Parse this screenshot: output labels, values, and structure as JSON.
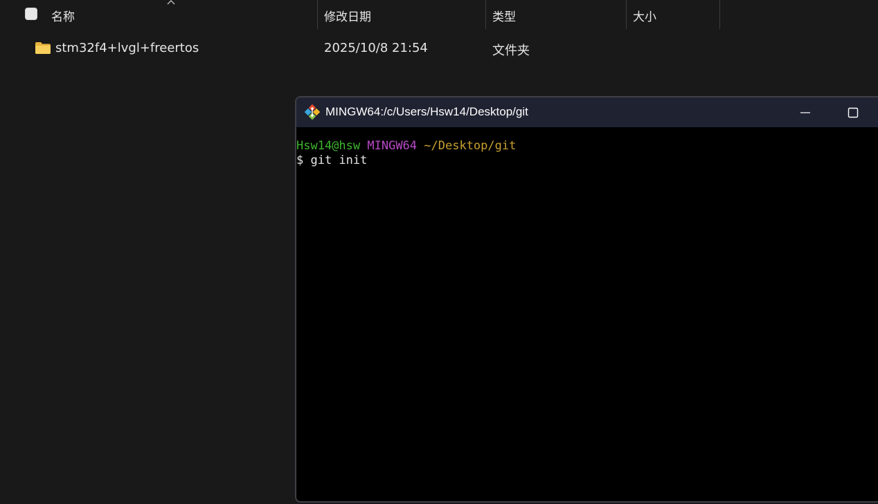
{
  "explorer": {
    "columns": {
      "name": "名称",
      "modified": "修改日期",
      "type": "类型",
      "size": "大小"
    },
    "rows": [
      {
        "name": "stm32f4+lvgl+freertos",
        "modified": "2025/10/8 21:54",
        "type": "文件夹",
        "size": "",
        "icon": "folder-icon"
      }
    ],
    "sort": "name ascending"
  },
  "terminal": {
    "title": "MINGW64:/c/Users/Hsw14/Desktop/git",
    "icon": "git-icon",
    "prompt": {
      "user_host": "Hsw14@hsw",
      "system": "MINGW64",
      "path": "~/Desktop/git"
    },
    "command_line": "$ git init",
    "colors": {
      "user_host": "#3fb52f",
      "system": "#b848c8",
      "path": "#c8a030",
      "background": "#000000"
    }
  }
}
